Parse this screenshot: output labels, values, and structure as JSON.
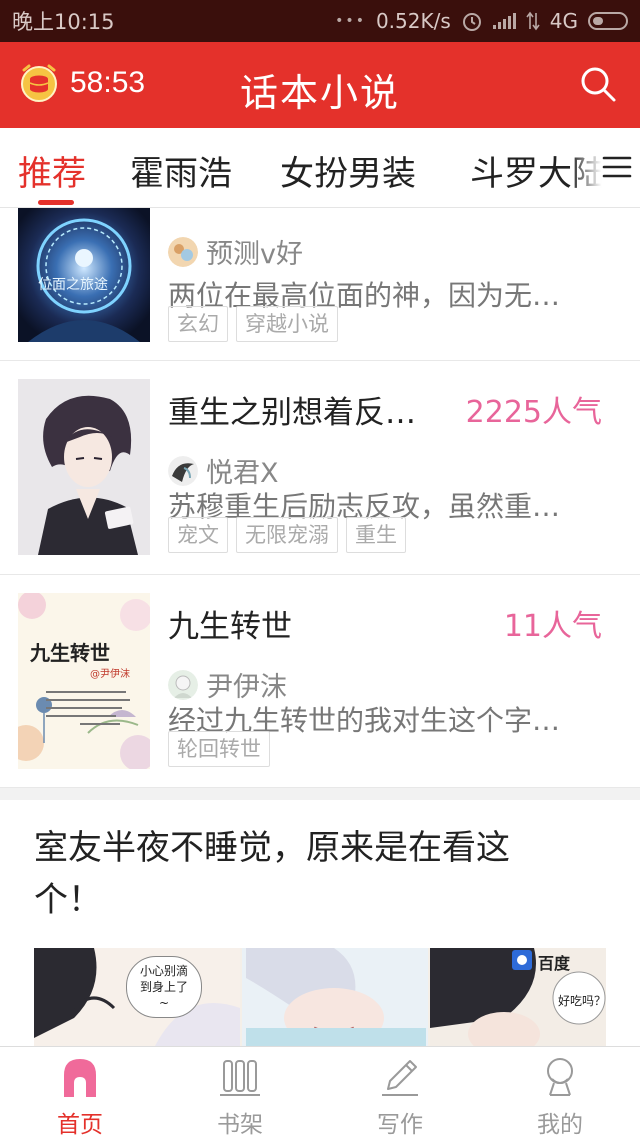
{
  "status_bar": {
    "time": "晚上10:15",
    "network_speed": "0.52K/s",
    "network_type": "4G"
  },
  "header": {
    "timer": "58:53",
    "title": "话本小说",
    "accent_color": "#e4312b"
  },
  "tabs": [
    {
      "label": "推荐",
      "active": true
    },
    {
      "label": "霍雨浩",
      "active": false
    },
    {
      "label": "女扮男装",
      "active": false
    },
    {
      "label": "斗罗大陆",
      "active": false
    }
  ],
  "books": [
    {
      "title": "",
      "popularity": "",
      "cover_text": "位面之旅途",
      "author": "预测v好",
      "description": "两位在最高位面的神，因为无…",
      "tags": [
        "玄幻",
        "穿越小说"
      ]
    },
    {
      "title": "重生之别想着反…",
      "popularity": "2225人气",
      "author": "悦君X",
      "description": "苏穆重生后励志反攻，虽然重…",
      "tags": [
        "宠文",
        "无限宠溺",
        "重生"
      ]
    },
    {
      "title": "九生转世",
      "popularity": "11人气",
      "cover_text": "九生转世",
      "cover_subtext": "@尹伊沫",
      "author": "尹伊沫",
      "description": "经过九生转世的我对生这个字…",
      "tags": [
        "轮回转世"
      ]
    }
  ],
  "promo": {
    "title": "室友半夜不睡觉，原来是在看这个！",
    "bubble_1": "小心别滴到身上了~",
    "bubble_2": "好吃吗？",
    "badge": "百度"
  },
  "bottom_nav": [
    {
      "label": "首页",
      "icon": "home-icon",
      "active": true
    },
    {
      "label": "书架",
      "icon": "bookshelf-icon",
      "active": false
    },
    {
      "label": "写作",
      "icon": "pen-icon",
      "active": false
    },
    {
      "label": "我的",
      "icon": "profile-icon",
      "active": false
    }
  ]
}
